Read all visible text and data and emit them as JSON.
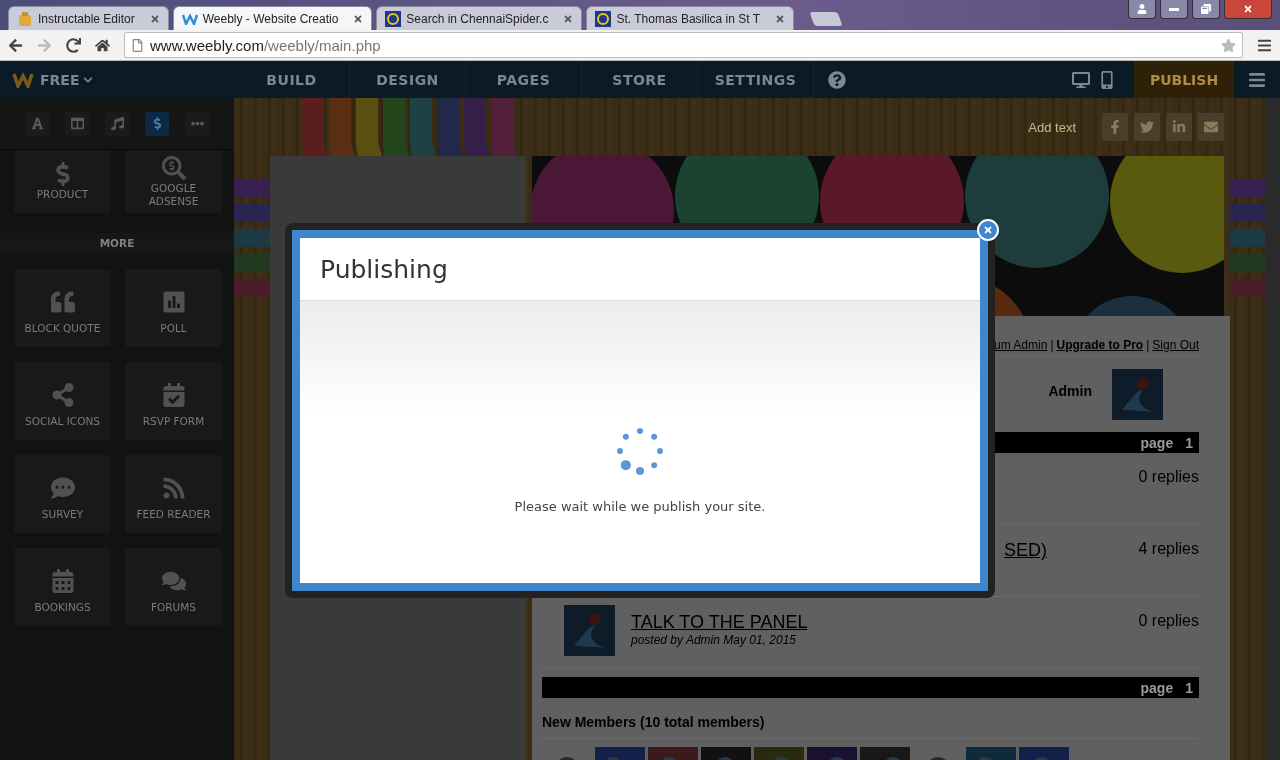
{
  "browser": {
    "tabs": [
      {
        "title": "Instructable Editor",
        "kind": "robot",
        "selected": false
      },
      {
        "title": "Weebly - Website Creatio",
        "kind": "weebly",
        "selected": true
      },
      {
        "title": "Search in ChennaiSpider.c",
        "kind": "spider",
        "selected": false
      },
      {
        "title": "St. Thomas Basilica in St T",
        "kind": "spider",
        "selected": false
      }
    ],
    "url_host": "www.weebly.com",
    "url_path": "/weebly/main.php"
  },
  "editor": {
    "plan": "FREE",
    "nav": [
      "BUILD",
      "DESIGN",
      "PAGES",
      "STORE",
      "SETTINGS"
    ],
    "publish": "PUBLISH"
  },
  "sidebar": {
    "categories": [
      {
        "kind": "text",
        "selected": false
      },
      {
        "kind": "layout",
        "selected": false
      },
      {
        "kind": "media",
        "selected": false
      },
      {
        "kind": "commerce",
        "selected": true
      },
      {
        "kind": "more",
        "selected": false
      }
    ],
    "elements_top": [
      {
        "label": "PRODUCT",
        "kind": "product"
      },
      {
        "label": "GOOGLE ADSENSE",
        "kind": "adsense"
      }
    ],
    "section": "MORE",
    "elements": [
      {
        "label": "BLOCK QUOTE",
        "kind": "quote"
      },
      {
        "label": "POLL",
        "kind": "poll"
      },
      {
        "label": "SOCIAL ICONS",
        "kind": "share"
      },
      {
        "label": "RSVP FORM",
        "kind": "rsvp"
      },
      {
        "label": "SURVEY",
        "kind": "survey"
      },
      {
        "label": "FEED READER",
        "kind": "feed"
      },
      {
        "label": "BOOKINGS",
        "kind": "bookings"
      },
      {
        "label": "FORUMS",
        "kind": "forums"
      }
    ]
  },
  "site": {
    "add_text": "Add text",
    "social": [
      {
        "kind": "facebook"
      },
      {
        "kind": "twitter"
      },
      {
        "kind": "linkedin"
      },
      {
        "kind": "mail"
      }
    ],
    "account_links": [
      {
        "kind": "link",
        "label": "um Admin",
        "bold": false
      },
      {
        "kind": "separator",
        "label": "|",
        "bold": false
      },
      {
        "kind": "link",
        "label": "Upgrade to Pro",
        "bold": true
      },
      {
        "kind": "separator",
        "label": "|",
        "bold": false
      },
      {
        "kind": "link",
        "label": "Sign Out",
        "bold": false
      }
    ],
    "user": "Admin",
    "pager_top": {
      "label": "page",
      "number": "1"
    },
    "topics": [
      {
        "replies": "0 replies"
      },
      {
        "title": "SED)",
        "replies": "4 replies"
      },
      {
        "title": "TALK TO THE PANEL",
        "byline": "posted by Admin May 01, 2015",
        "replies": "0 replies",
        "avatar": true
      }
    ],
    "pager_bottom": {
      "label": "page",
      "number": "1"
    },
    "members_heading": "New Members (10 total members)",
    "members": [
      {
        "kind": "silhouette"
      },
      {
        "kind": "picture"
      },
      {
        "kind": "picture"
      },
      {
        "kind": "picture"
      },
      {
        "kind": "picture"
      },
      {
        "kind": "picture"
      },
      {
        "kind": "picture"
      },
      {
        "kind": "silhouette"
      },
      {
        "kind": "picture"
      },
      {
        "kind": "picture"
      }
    ]
  },
  "modal": {
    "title": "Publishing",
    "message": "Please wait while we publish your site."
  }
}
